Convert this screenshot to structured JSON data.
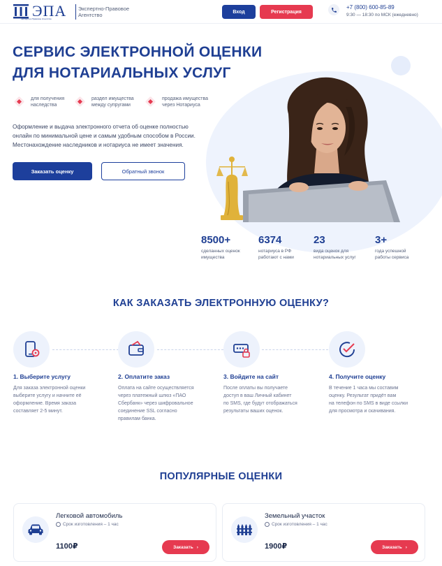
{
  "header": {
    "logo_text": "ЭПА",
    "logo_sub": "Экспертно-Правовое Агентство",
    "tagline_1": "Экспертно-Правовое",
    "tagline_2": "Агентство",
    "login_label": "Вход",
    "register_label": "Регистрация",
    "phone": "+7 (800) 600-85-89",
    "hours": "9:30 — 18:30 по МСК (ежедневно)"
  },
  "hero": {
    "title_line1": "СЕРВИС ЭЛЕКТРОННОЙ ОЦЕНКИ",
    "title_line2": "ДЛЯ НОТАРИАЛЬНЫХ УСЛУГ",
    "features": [
      {
        "l1": "для получения",
        "l2": "наследства"
      },
      {
        "l1": "раздел имущества",
        "l2": "между супругами"
      },
      {
        "l1": "продажа имущества",
        "l2": "через Нотариуса"
      }
    ],
    "desc_1": "Оформление и выдача электронного отчета об оценке полностью",
    "desc_2": "онлайн по минимальной цене и самым удобным способом в России.",
    "desc_3": "Местонахождение наследников и нотариуса не имеет значения.",
    "order_label": "Заказать оценку",
    "call_label": "Обратный звонок"
  },
  "stats": [
    {
      "num": "8500+",
      "l1": "сделанных оценок",
      "l2": "имущества"
    },
    {
      "num": "6374",
      "l1": "нотариуса в РФ",
      "l2": "работают с нами"
    },
    {
      "num": "23",
      "l1": "вида оценок для",
      "l2": "нотариальных услуг"
    },
    {
      "num": "3+",
      "l1": "года успешной",
      "l2": "работы сервиса"
    }
  ],
  "how": {
    "title": "КАК ЗАКАЗАТЬ ЭЛЕКТРОННУЮ ОЦЕНКУ?",
    "steps": [
      {
        "title": "1. Выберите услугу",
        "d1": "Для заказа электронной оценки",
        "d2": "выберите услугу и начните её",
        "d3": "оформление. Время заказа",
        "d4": "составляет 2-5 минут."
      },
      {
        "title": "2. Оплатите заказ",
        "d1": "Оплата на сайте осуществляется",
        "d2": "через платежный шлюз «ПАО",
        "d3": "Сбербанк» через шифровальное",
        "d4": "соединение SSL согласно",
        "d5": "правилам банка."
      },
      {
        "title": "3. Войдите на сайт",
        "d1": "После оплаты вы получаете",
        "d2": "доступ в ваш Личный кабинет",
        "d3": "по SMS, где будут отображаться",
        "d4": "результаты ваших оценок."
      },
      {
        "title": "4. Получите оценку",
        "d1": "В течение 1 часа мы составим",
        "d2": "оценку. Результат придёт вам",
        "d3": "на телефон по SMS в виде ссылки",
        "d4": "для просмотра и скачивания."
      }
    ]
  },
  "popular": {
    "title": "ПОПУЛЯРНЫЕ ОЦЕНКИ",
    "cards": [
      {
        "title": "Легковой автомобиль",
        "term": "Срок изготовления – 1 час",
        "price": "1100₽",
        "button": "Заказать",
        "icon": "car-icon"
      },
      {
        "title": "Земельный участок",
        "term": "Срок изготовления – 1 час",
        "price": "1900₽",
        "button": "Заказать",
        "icon": "fence-icon"
      }
    ]
  },
  "colors": {
    "primary": "#1d3f9c",
    "accent": "#e63a50",
    "light": "#edf2fc"
  }
}
